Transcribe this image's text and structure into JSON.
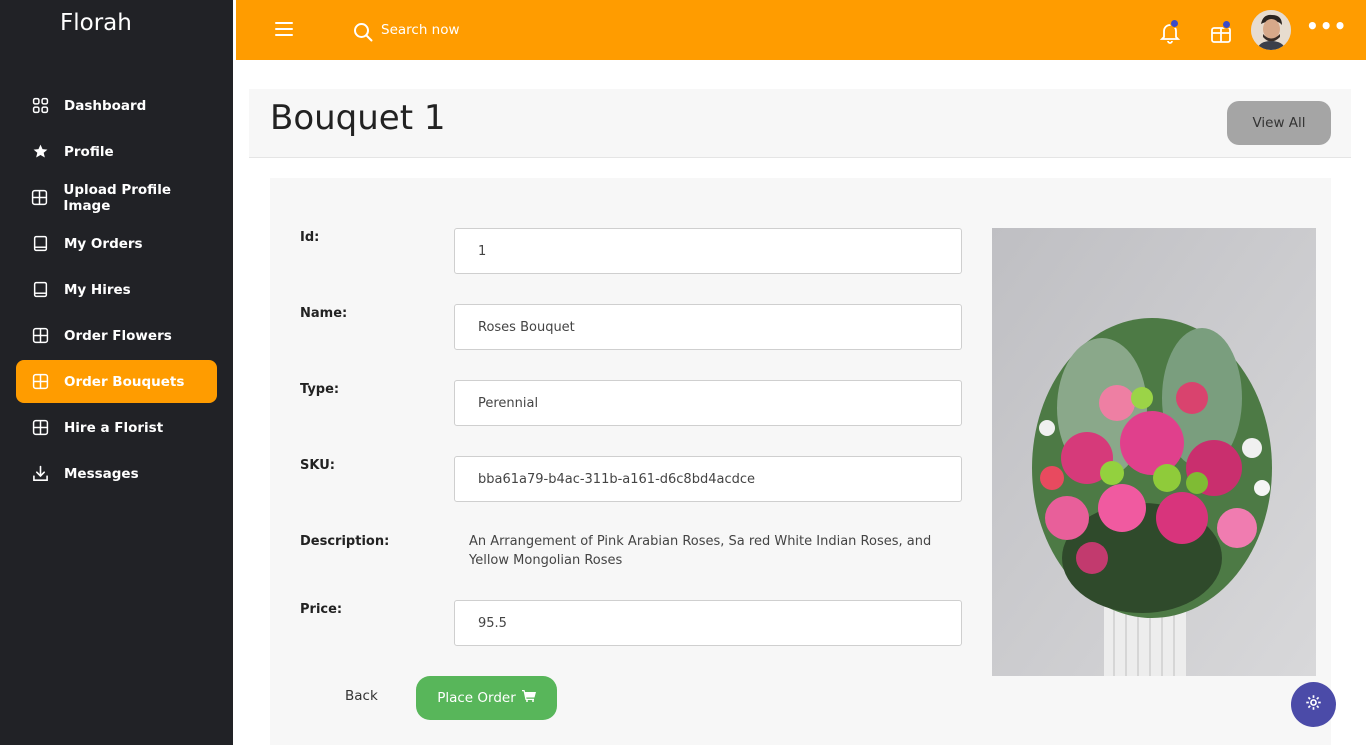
{
  "brand": "Florah",
  "sidebar": {
    "items": [
      {
        "label": "Dashboard",
        "icon": "grid-icon"
      },
      {
        "label": "Profile",
        "icon": "star-icon"
      },
      {
        "label": "Upload Profile Image",
        "icon": "plus-square-icon"
      },
      {
        "label": "My Orders",
        "icon": "book-icon"
      },
      {
        "label": "My Hires",
        "icon": "book-icon"
      },
      {
        "label": "Order Flowers",
        "icon": "plus-square-icon"
      },
      {
        "label": "Order Bouquets",
        "icon": "plus-square-icon",
        "active": true
      },
      {
        "label": "Hire a Florist",
        "icon": "plus-square-icon"
      },
      {
        "label": "Messages",
        "icon": "download-icon"
      }
    ]
  },
  "topbar": {
    "search_placeholder": "Search now",
    "accent_color": "#ff9c00",
    "badge_color": "#3a4bc9"
  },
  "header": {
    "title": "Bouquet 1",
    "view_all_label": "View All"
  },
  "form": {
    "id_label": "Id:",
    "id_value": "1",
    "name_label": "Name:",
    "name_value": "Roses Bouquet",
    "type_label": "Type:",
    "type_value": "Perennial",
    "sku_label": "SKU:",
    "sku_value": "bba61a79-b4ac-311b-a161-d6c8bd4acdce",
    "description_label": "Description:",
    "description_value": "An Arrangement of Pink Arabian Roses, Sa red White Indian Roses, and Yellow Mongolian Roses",
    "price_label": "Price:",
    "price_value": "95.5"
  },
  "actions": {
    "back_label": "Back",
    "place_order_label": "Place Order"
  }
}
